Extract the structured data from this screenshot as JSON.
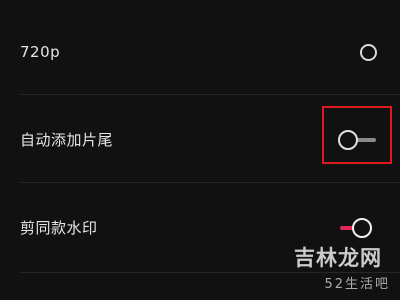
{
  "settings": {
    "items": [
      {
        "label": "720p",
        "control": "radio",
        "selected": false
      },
      {
        "label": "自动添加片尾",
        "control": "toggle",
        "on": false,
        "highlighted": true
      },
      {
        "label": "剪同款水印",
        "control": "toggle",
        "on": true
      }
    ]
  },
  "colors": {
    "background": "#111111",
    "accent": "#e0275a",
    "highlight_border": "#e0191f"
  },
  "watermark": {
    "main": "吉林龙网",
    "sub": "52生活吧"
  }
}
